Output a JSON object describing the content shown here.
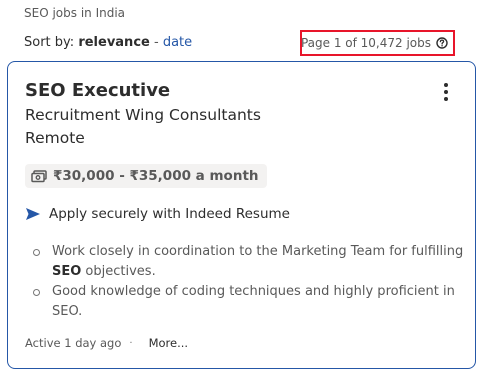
{
  "breadcrumb": "SEO jobs in India",
  "sort": {
    "label": "Sort by:",
    "active": "relevance",
    "separator": " - ",
    "alternative": "date"
  },
  "page_count": {
    "text": "Page 1 of 10,472 jobs",
    "icon": "question-circle-icon",
    "highlight_color": "#e8152a"
  },
  "job": {
    "title": "SEO Executive",
    "company": "Recruitment Wing Consultants",
    "location": "Remote",
    "salary": "₹30,000 - ₹35,000 a month",
    "salary_icon": "money-icon",
    "apply_text": "Apply securely with Indeed Resume",
    "apply_icon": "arrow-send-icon",
    "snippet": [
      {
        "before": "Work closely in coordination to the Marketing Team for fulfilling ",
        "bold": "SEO",
        "after": " objectives."
      },
      {
        "before": "Good knowledge of coding techniques and highly proficient in SEO.",
        "bold": "",
        "after": ""
      }
    ],
    "active": "Active 1 day ago",
    "separator": "·",
    "more": "More...",
    "menu_icon": "more-vertical-icon"
  },
  "colors": {
    "accent": "#2557a7",
    "text": "#2d2d2d",
    "muted": "#595959",
    "salary_bg": "#f3f2f1"
  }
}
